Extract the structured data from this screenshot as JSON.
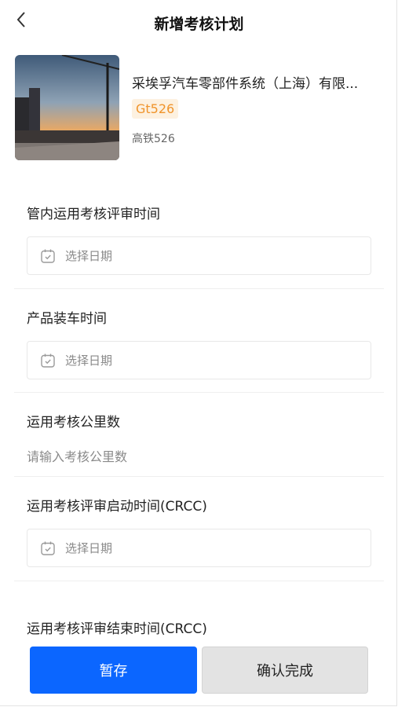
{
  "header": {
    "title": "新增考核计划"
  },
  "product": {
    "name": "采埃孚汽车零部件系统（上海）有限...",
    "tag": "Gt526",
    "code": "高铁526"
  },
  "form": {
    "review_time": {
      "label": "管内运用考核评审时间",
      "placeholder": "选择日期"
    },
    "install_time": {
      "label": "产品装车时间",
      "placeholder": "选择日期"
    },
    "mileage": {
      "label": "运用考核公里数",
      "placeholder": "请输入考核公里数"
    },
    "crcc_start": {
      "label": "运用考核评审启动时间(CRCC)",
      "placeholder": "选择日期"
    },
    "crcc_end": {
      "label": "运用考核评审结束时间(CRCC)"
    }
  },
  "footer": {
    "save_label": "暂存",
    "confirm_label": "确认完成"
  },
  "colors": {
    "primary": "#0b66ff",
    "tag_text": "#f0942b",
    "tag_bg": "#fdf1e0"
  },
  "icons": {
    "back": "chevron-left-icon",
    "calendar": "calendar-icon"
  }
}
